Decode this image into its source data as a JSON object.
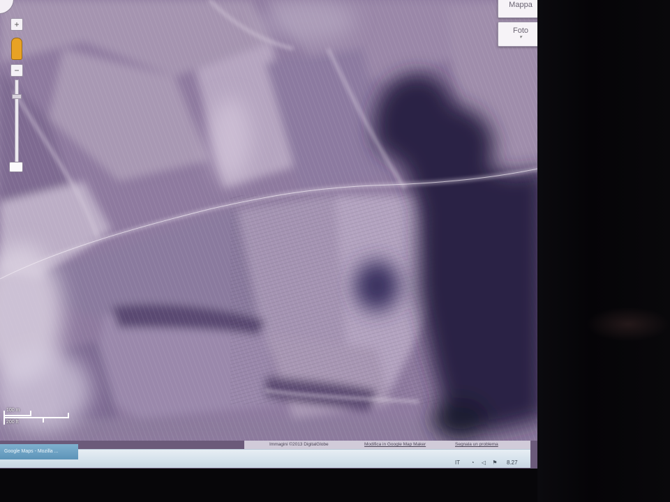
{
  "map": {
    "type_buttons": {
      "map_label": "Mappa",
      "photo_label": "Foto",
      "photo_caret": "▾"
    },
    "zoom": {
      "in_symbol": "+",
      "out_symbol": "−"
    },
    "scale": {
      "top_label": "100 m",
      "bottom_label": "200 ft"
    },
    "attribution": {
      "imagery": "Immagini ©2013 DigitalGlobe",
      "map_data": "Modifica in Google Map Maker",
      "report": "Segnala un problema"
    }
  },
  "taskbar": {
    "task_label": "Google Maps - Mozilla ...",
    "language": "IT",
    "clock": "8.27",
    "tray_icons": [
      "network-icon",
      "volume-icon",
      "flag-icon"
    ]
  },
  "colors": {
    "terrain_light": "#b9a8c2",
    "terrain_mid": "#8e7a9f",
    "terrain_dark": "#5b4a70",
    "shadow_dark": "#26203f",
    "road": "#d8cedd"
  }
}
